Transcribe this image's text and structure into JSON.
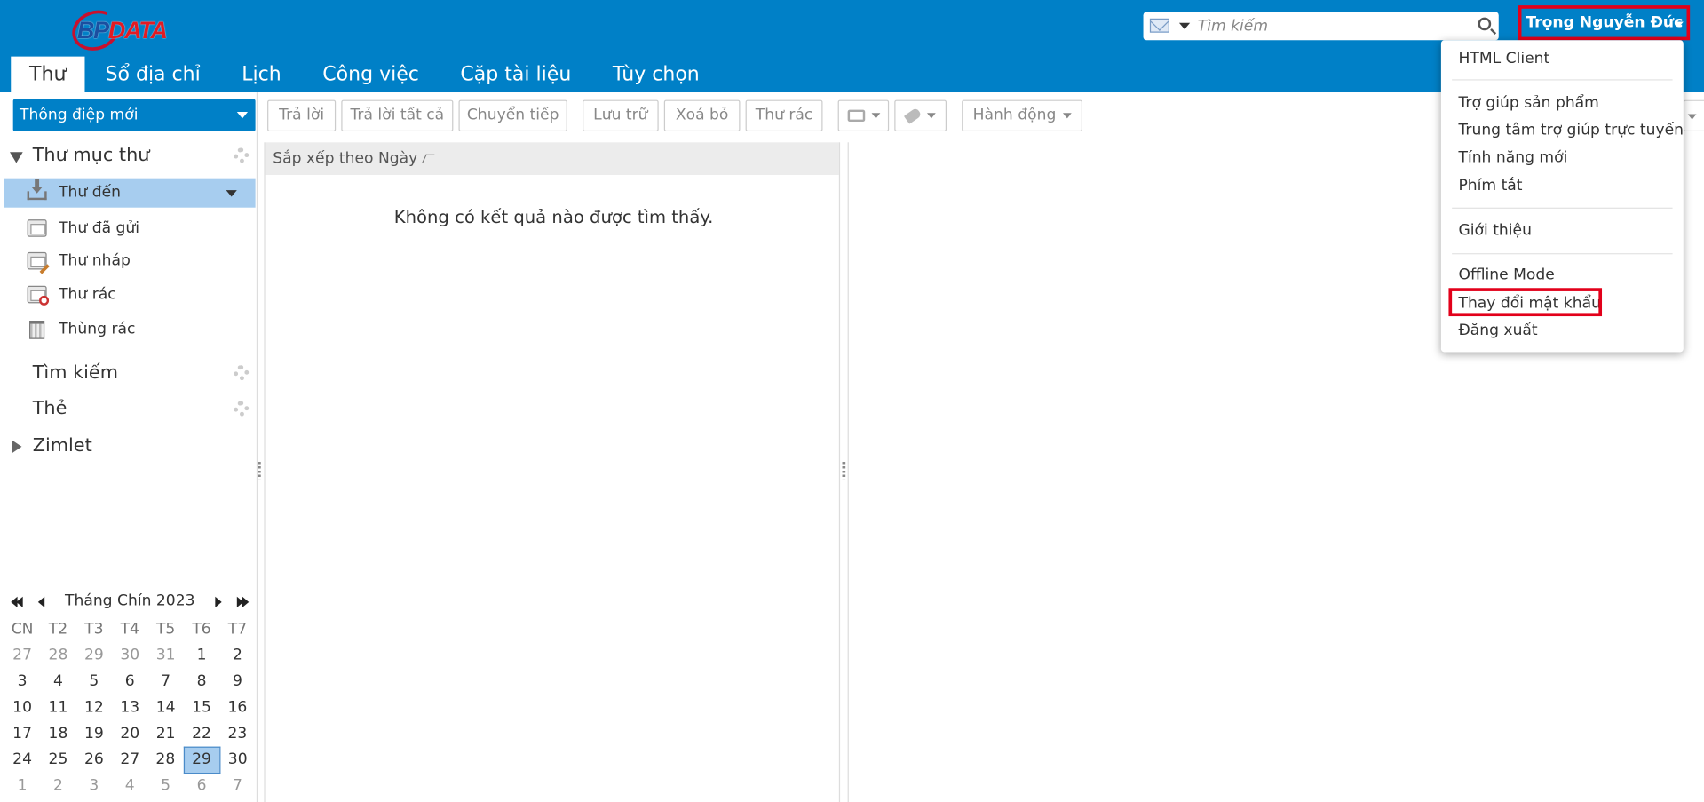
{
  "header": {
    "logo_text_bp": "BP",
    "logo_text_rest": "DATA",
    "search_placeholder": "Tìm kiếm",
    "user_name": "Trọng Nguyễn Đức"
  },
  "tabs": [
    {
      "label": "Thư",
      "active": true
    },
    {
      "label": "Sổ địa chỉ"
    },
    {
      "label": "Lịch"
    },
    {
      "label": "Công việc"
    },
    {
      "label": "Cặp tài liệu"
    },
    {
      "label": "Tùy chọn"
    }
  ],
  "toolbar": {
    "new_message": "Thông điệp mới",
    "reply": "Trả lời",
    "reply_all": "Trả lời tất cả",
    "forward": "Chuyển tiếp",
    "archive": "Lưu trữ",
    "delete": "Xoá bỏ",
    "spam": "Thư rác",
    "actions": "Hành động"
  },
  "sidebar": {
    "mail_folders_heading": "Thư mục thư",
    "folders": [
      {
        "label": "Thư đến",
        "selected": true
      },
      {
        "label": "Thư đã gửi"
      },
      {
        "label": "Thư nháp"
      },
      {
        "label": "Thư rác"
      },
      {
        "label": "Thùng rác"
      }
    ],
    "search_heading": "Tìm kiếm",
    "tags_heading": "Thẻ",
    "zimlet_heading": "Zimlet"
  },
  "list": {
    "sort_label": "Sắp xếp theo Ngày",
    "empty_message": "Không có kết quả nào được tìm thấy."
  },
  "calendar": {
    "month_title": "Tháng Chín 2023",
    "weekdays": [
      "CN",
      "T2",
      "T3",
      "T4",
      "T5",
      "T6",
      "T7"
    ],
    "weeks": [
      [
        "27",
        "28",
        "29",
        "30",
        "31",
        "1",
        "2"
      ],
      [
        "3",
        "4",
        "5",
        "6",
        "7",
        "8",
        "9"
      ],
      [
        "10",
        "11",
        "12",
        "13",
        "14",
        "15",
        "16"
      ],
      [
        "17",
        "18",
        "19",
        "20",
        "21",
        "22",
        "23"
      ],
      [
        "24",
        "25",
        "26",
        "27",
        "28",
        "29",
        "30"
      ],
      [
        "1",
        "2",
        "3",
        "4",
        "5",
        "6",
        "7"
      ]
    ],
    "today": "29"
  },
  "user_menu": {
    "html_client": "HTML Client",
    "product_help": "Trợ giúp sản phẩm",
    "online_help": "Trung tâm trợ giúp trực tuyến",
    "new_features": "Tính năng mới",
    "shortcuts": "Phím tắt",
    "about": "Giới thiệu",
    "offline_mode": "Offline Mode",
    "change_password": "Thay đổi mật khẩu",
    "logout": "Đăng xuất"
  },
  "colors": {
    "header_blue": "#0080c7",
    "selection_blue": "#a7cdef",
    "highlight_red": "#e2001a"
  }
}
